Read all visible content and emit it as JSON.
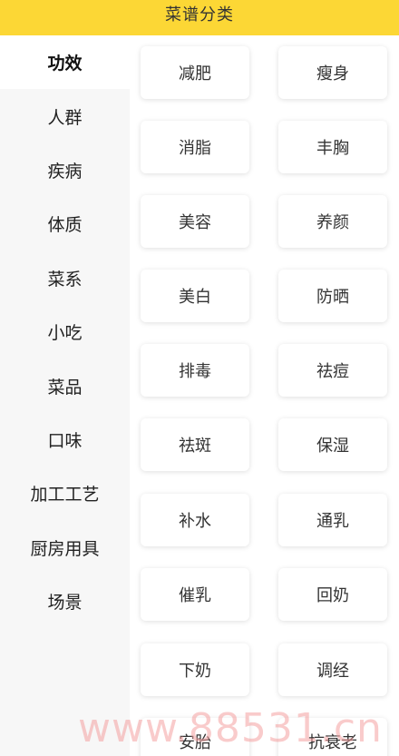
{
  "header": {
    "title": "菜谱分类"
  },
  "sidebar": {
    "items": [
      {
        "label": "功效",
        "active": true
      },
      {
        "label": "人群"
      },
      {
        "label": "疾病"
      },
      {
        "label": "体质"
      },
      {
        "label": "菜系"
      },
      {
        "label": "小吃"
      },
      {
        "label": "菜品"
      },
      {
        "label": "口味"
      },
      {
        "label": "加工工艺"
      },
      {
        "label": "厨房用具"
      },
      {
        "label": "场景"
      }
    ]
  },
  "main": {
    "tags": [
      "减肥",
      "瘦身",
      "消脂",
      "丰胸",
      "美容",
      "养颜",
      "美白",
      "防晒",
      "排毒",
      "祛痘",
      "祛斑",
      "保湿",
      "补水",
      "通乳",
      "催乳",
      "回奶",
      "下奶",
      "调经",
      "安胎",
      "抗衰老"
    ]
  },
  "watermark": {
    "text": "www.88531.cn"
  }
}
